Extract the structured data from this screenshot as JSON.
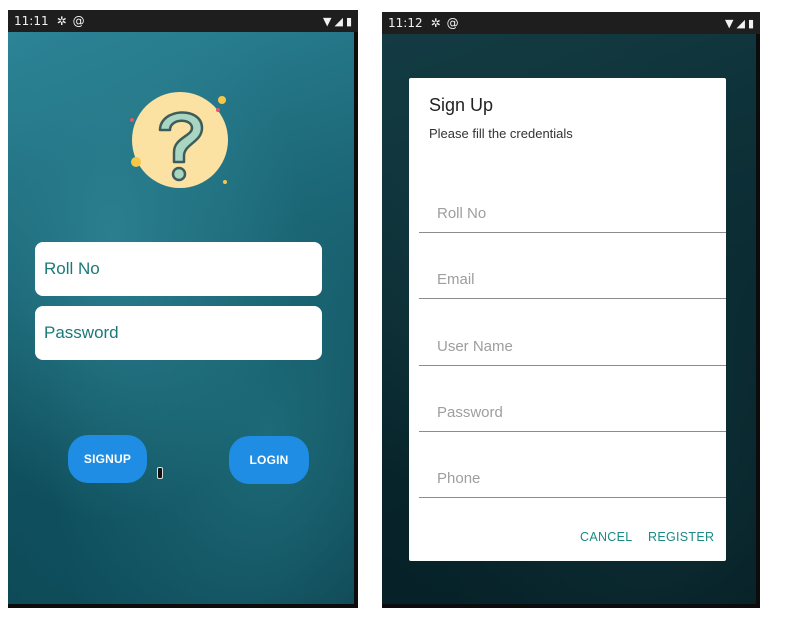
{
  "left_screen": {
    "status": {
      "time": "11:11",
      "icons": [
        "gear-icon",
        "at-icon"
      ],
      "right_icons": [
        "wifi-icon",
        "signal-icon",
        "battery-icon"
      ]
    },
    "logo": {
      "icon": "question-mark-icon",
      "symbol": "?"
    },
    "roll_field": {
      "placeholder": "Roll No"
    },
    "password_field": {
      "placeholder": "Password"
    },
    "signup_label": "SIGNUP",
    "login_label": "LOGIN",
    "colors": {
      "button": "#1f8de3",
      "field_text": "#1a7a78",
      "logo_circle": "#fbe2a3"
    }
  },
  "right_screen": {
    "status": {
      "time": "11:12",
      "icons": [
        "gear-icon",
        "at-icon"
      ],
      "right_icons": [
        "wifi-icon",
        "signal-icon",
        "battery-icon"
      ]
    },
    "dialog": {
      "title": "Sign Up",
      "message": "Please fill the credentials",
      "fields": [
        {
          "placeholder": "Roll No"
        },
        {
          "placeholder": "Email"
        },
        {
          "placeholder": "User Name"
        },
        {
          "placeholder": "Password"
        },
        {
          "placeholder": "Phone"
        }
      ],
      "cancel_label": "CANCEL",
      "register_label": "REGISTER",
      "accent": "#1a8a85"
    }
  }
}
